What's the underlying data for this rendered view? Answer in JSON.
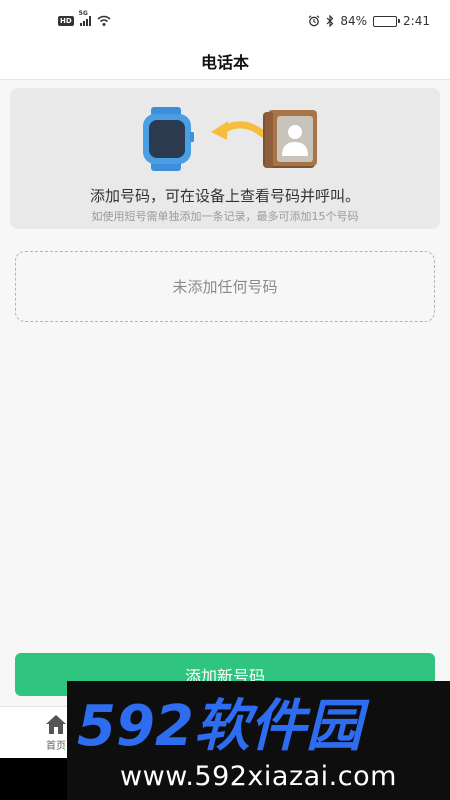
{
  "status_bar": {
    "hd": "HD",
    "network": "5G",
    "battery_percent": "84%",
    "battery_level": 0.84,
    "time": "2:41",
    "icons": [
      "hd-icon",
      "signal-icon",
      "wifi-icon",
      "alarm-icon",
      "bluetooth-icon",
      "battery-icon"
    ]
  },
  "header": {
    "title": "电话本"
  },
  "banner": {
    "main_text": "添加号码，可在设备上查看号码并呼叫。",
    "sub_text": "如使用短号需单独添加一条记录，最多可添加15个号码",
    "icons": [
      "watch-icon",
      "arrow-left-icon",
      "contact-book-icon"
    ]
  },
  "empty_state": {
    "text": "未添加任何号码"
  },
  "actions": {
    "add_number_label": "添加新号码"
  },
  "bottom_nav": {
    "home_label": "首页"
  },
  "watermark": {
    "logo_text": "592软件园",
    "url": "www.592xiazai.com"
  },
  "colors": {
    "accent": "#2fc47f",
    "watch_blue": "#4a9ee6",
    "arrow_yellow": "#f7bd3c",
    "book_brown": "#9a6a42",
    "watermark_blue": "#2e6cf0"
  }
}
